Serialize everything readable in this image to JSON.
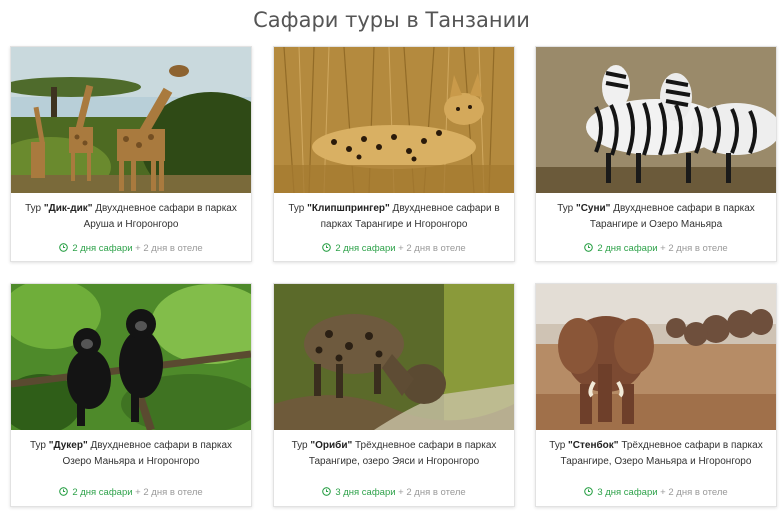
{
  "page": {
    "title": "Сафари туры в Танзании"
  },
  "colors": {
    "safari_green": "#2ea24a",
    "hotel_gray": "#9a9a9a"
  },
  "tours": [
    {
      "prefix": "Тур ",
      "name": "\"Дик-дик\"",
      "description": " Двухдневное сафари в парках Аруша и Нгоронгоро",
      "safari": "2 дня сафари",
      "hotel": " + 2 дня в отеле",
      "icon": "clock-icon",
      "image": "giraffes-photo"
    },
    {
      "prefix": "Тур ",
      "name": "\"Клипшпрингер\"",
      "description": " Двухдневное сафари в парках Тарангире и Нгоронгоро",
      "safari": "2 дня сафари",
      "hotel": " + 2 дня в отеле",
      "icon": "clock-icon",
      "image": "serval-photo"
    },
    {
      "prefix": "Тур ",
      "name": "\"Суни\"",
      "description": " Двухдневное сафари в парках Тарангире и Озеро Маньяра",
      "safari": "2 дня сафари",
      "hotel": " + 2 дня в отеле",
      "icon": "clock-icon",
      "image": "zebras-photo"
    },
    {
      "prefix": "Тур ",
      "name": "\"Дукер\"",
      "description": " Двухдневное сафари в парках Озеро Маньяра и Нгоронгоро",
      "safari": "2 дня сафари",
      "hotel": " + 2 дня в отеле",
      "icon": "clock-icon",
      "image": "monkeys-photo"
    },
    {
      "prefix": "Тур ",
      "name": "\"Ориби\"",
      "description": " Трёхдневное сафари в парках Тарангире, озеро Эяси и Нгоронгоро",
      "safari": "3 дня сафари",
      "hotel": " + 2 дня в отеле",
      "icon": "clock-icon",
      "image": "hyena-photo"
    },
    {
      "prefix": "Тур ",
      "name": "\"Стенбок\"",
      "description": " Трёхдневное сафари в парках Тарангире, Озеро Маньяра и Нгоронгоро",
      "safari": "3 дня сафари",
      "hotel": " + 2 дня в отеле",
      "icon": "clock-icon",
      "image": "elephants-photo"
    }
  ]
}
